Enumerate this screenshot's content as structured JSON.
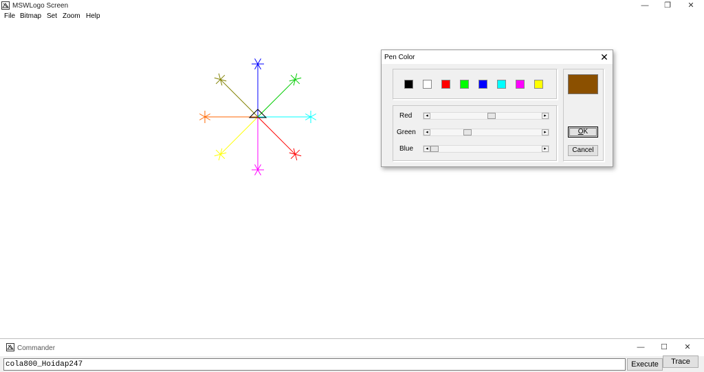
{
  "window": {
    "title": "MSWLogo Screen",
    "minimize_glyph": "—",
    "maximize_glyph": "❐",
    "close_glyph": "✕",
    "icon": "mswlogo-app-icon"
  },
  "menu": {
    "items": [
      "File",
      "Bitmap",
      "Set",
      "Zoom",
      "Help"
    ]
  },
  "drawing": {
    "arms": [
      {
        "color": "#0000ff"
      },
      {
        "color": "#00cc00"
      },
      {
        "color": "#00ffff"
      },
      {
        "color": "#ff0000"
      },
      {
        "color": "#ff00ff"
      },
      {
        "color": "#ffff00"
      },
      {
        "color": "#ff6600"
      },
      {
        "color": "#808000"
      }
    ],
    "turtle_color": "#000000"
  },
  "pen_color_dialog": {
    "title": "Pen Color",
    "close_glyph": "✕",
    "palette": [
      "#000000",
      "#ffffff",
      "#ff0000",
      "#00ff00",
      "#0000ff",
      "#00ffff",
      "#ff00ff",
      "#ffff00"
    ],
    "sliders": [
      {
        "label": "Red",
        "value": 139,
        "max": 255
      },
      {
        "label": "Green",
        "value": 80,
        "max": 255
      },
      {
        "label": "Blue",
        "value": 0,
        "max": 255
      }
    ],
    "preview_color": "#8b5000",
    "ok_label": "OK",
    "cancel_label": "Cancel"
  },
  "commander": {
    "title": "Commander",
    "input_value": "cola800_Hoidap247",
    "execute_label": "Execute",
    "trace_label": "Trace",
    "minimize_glyph": "—",
    "maximize_glyph": "☐",
    "close_glyph": "✕"
  }
}
